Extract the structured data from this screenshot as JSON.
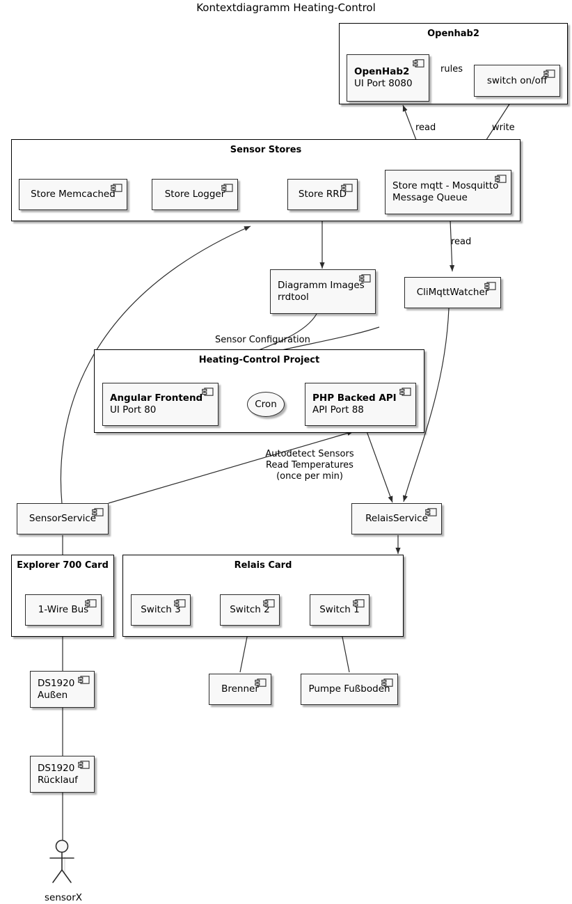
{
  "title": "Kontextdiagramm Heating-Control",
  "packages": [
    {
      "id": "openhab2",
      "label": "Openhab2"
    },
    {
      "id": "sensor-stores",
      "label": "Sensor Stores"
    },
    {
      "id": "heating-control-project",
      "label": "Heating-Control Project"
    },
    {
      "id": "explorer-700-card",
      "label": "Explorer 700 Card"
    },
    {
      "id": "relais-card",
      "label": "Relais Card"
    }
  ],
  "components": [
    {
      "id": "openhab2-ui",
      "line1": "OpenHab2",
      "line2": "UI Port 8080"
    },
    {
      "id": "switch-on-off",
      "line1": "switch on/off",
      "line2": ""
    },
    {
      "id": "store-memcached",
      "line1": "Store Memcached",
      "line2": ""
    },
    {
      "id": "store-logger",
      "line1": "Store Logger",
      "line2": ""
    },
    {
      "id": "store-rrd",
      "line1": "Store RRD",
      "line2": ""
    },
    {
      "id": "store-mqtt",
      "line1": "Store mqtt - Mosquitto",
      "line2": "Message Queue"
    },
    {
      "id": "diagramm-images",
      "line1": "Diagramm Images",
      "line2": "rrdtool"
    },
    {
      "id": "climqttwatcher",
      "line1": "CliMqttWatcher",
      "line2": ""
    },
    {
      "id": "angular-frontend",
      "line1": "Angular Frontend",
      "line2": "UI Port 80"
    },
    {
      "id": "php-backed-api",
      "line1": "PHP Backed API",
      "line2": "API Port 88"
    },
    {
      "id": "sensorservice",
      "line1": "SensorService",
      "line2": ""
    },
    {
      "id": "relaisservice",
      "line1": "RelaisService",
      "line2": ""
    },
    {
      "id": "one-wire-bus",
      "line1": "1-Wire Bus",
      "line2": ""
    },
    {
      "id": "switch-3",
      "line1": "Switch 3",
      "line2": ""
    },
    {
      "id": "switch-2",
      "line1": "Switch 2",
      "line2": ""
    },
    {
      "id": "switch-1",
      "line1": "Switch 1",
      "line2": ""
    },
    {
      "id": "brenner",
      "line1": "Brenner",
      "line2": ""
    },
    {
      "id": "pumpe-fussboden",
      "line1": "Pumpe Fußboden",
      "line2": ""
    },
    {
      "id": "ds1920-aussen",
      "line1": "DS1920",
      "line2": "Außen"
    },
    {
      "id": "ds1920-ruecklauf",
      "line1": "DS1920",
      "line2": "Rücklauf"
    }
  ],
  "interfaces": [
    {
      "id": "cron",
      "label": "Cron"
    }
  ],
  "actors": [
    {
      "id": "sensorx",
      "label": "sensorX"
    }
  ],
  "edge_labels": [
    {
      "id": "rules",
      "text": "rules"
    },
    {
      "id": "read-mqtt-openhab",
      "text": "read"
    },
    {
      "id": "write-switch-mqtt",
      "text": "write"
    },
    {
      "id": "read-mqtt-cli",
      "text": "read"
    },
    {
      "id": "sensor-configuration",
      "text": "Sensor Configuration"
    },
    {
      "id": "autodetect",
      "text": "Autodetect Sensors\nRead Temperatures\n(once per min)"
    }
  ],
  "colors": {
    "component_fill": "#F8F8F8",
    "component_border": "#2B2B2B",
    "package_border": "#000000",
    "background": "#FFFFFF",
    "text": "#000000",
    "line": "#2B2B2B"
  }
}
